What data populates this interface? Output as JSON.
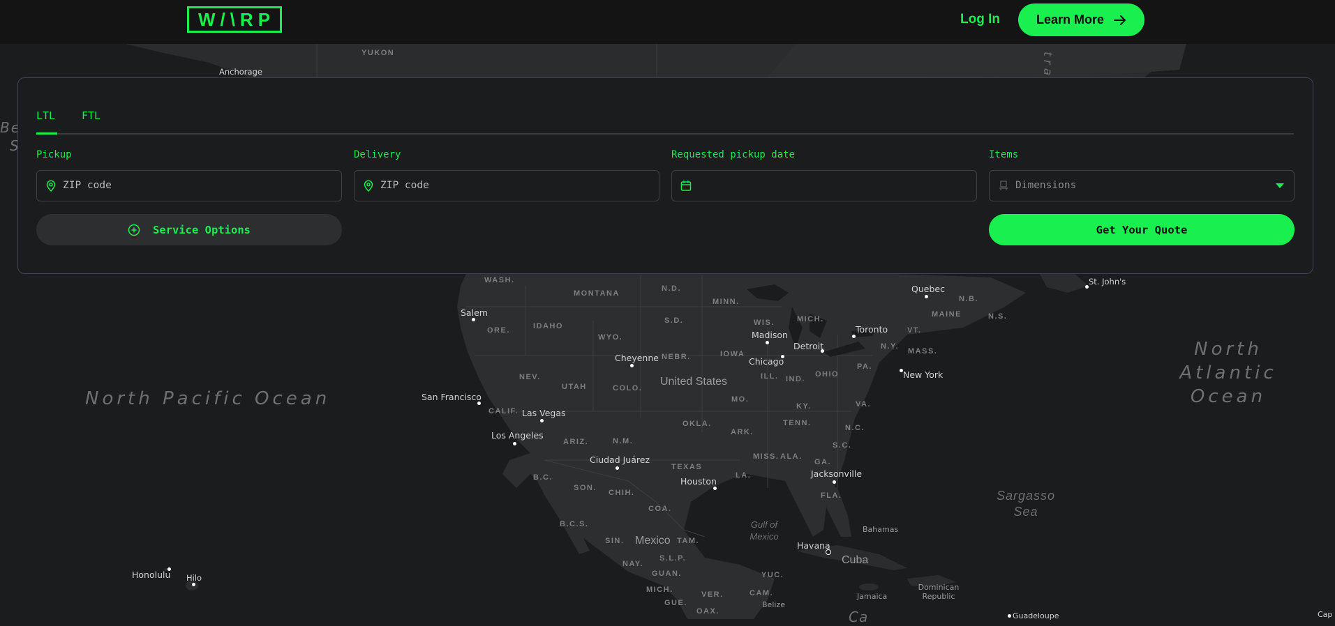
{
  "brand": {
    "logo_text": "W/\\RP",
    "accent": "#19ef4e"
  },
  "header": {
    "login_label": "Log In",
    "learn_more_label": "Learn More",
    "learn_more_icon": "arrow-right-icon"
  },
  "quote_form": {
    "tabs": [
      {
        "label": "LTL",
        "active": true
      },
      {
        "label": "FTL",
        "active": false
      }
    ],
    "fields": {
      "pickup": {
        "label": "Pickup",
        "placeholder": "ZIP code",
        "icon": "location-pin-icon"
      },
      "delivery": {
        "label": "Delivery",
        "placeholder": "ZIP code",
        "icon": "location-pin-icon"
      },
      "pickup_date": {
        "label": "Requested pickup date",
        "placeholder": "",
        "icon": "calendar-icon"
      },
      "items": {
        "label": "Items",
        "placeholder": "Dimensions",
        "icon": "pallet-icon"
      }
    },
    "service_options_label": "Service Options",
    "service_options_icon": "plus-circle-icon",
    "get_quote_label": "Get Your Quote"
  },
  "map": {
    "oceans": [
      "North Pacific Ocean",
      "North Atlantic Ocean",
      "Sargasso Sea",
      "Gulf of Mexico"
    ],
    "countries": [
      "United States",
      "Mexico",
      "Cuba"
    ],
    "partial_labels": {
      "be": "Be",
      "s": "S",
      "trait": "trait",
      "ca": "Ca",
      "cap": "Cap"
    },
    "cities": {
      "anchorage": "Anchorage",
      "salem": "Salem",
      "san_francisco": "San Francisco",
      "las_vegas": "Las Vegas",
      "los_angeles": "Los Angeles",
      "cheyenne": "Cheyenne",
      "madison": "Madison",
      "chicago": "Chicago",
      "detroit": "Detroit",
      "toronto": "Toronto",
      "quebec": "Quebec",
      "st_johns": "St. John's",
      "new_york": "New York",
      "ciudad_juarez": "Ciudad Juárez",
      "houston": "Houston",
      "jacksonville": "Jacksonville",
      "havana": "Havana",
      "bahamas": "Bahamas",
      "jamaica": "Jamaica",
      "dominican_republic": "Dominican Republic",
      "belize": "Belize",
      "guadeloupe": "Guadeloupe",
      "honolulu": "Honolulu",
      "hilo": "Hilo"
    },
    "regions": {
      "yukon": "YUKON",
      "wash": "WASH.",
      "ore": "ORE.",
      "idaho": "IDAHO",
      "montana": "MONTANA",
      "nd": "N.D.",
      "sd": "S.D.",
      "minn": "MINN.",
      "wis": "WIS.",
      "mich": "MICH.",
      "nb": "N.B.",
      "maine": "MAINE",
      "ns": "N.S.",
      "vt": "VT.",
      "ny": "N.Y.",
      "mass": "MASS.",
      "pa": "PA.",
      "ohio": "OHIO",
      "ind": "IND.",
      "ill": "ILL.",
      "iowa": "IOWA",
      "nebr": "NEBR.",
      "wyo": "WYO.",
      "nev": "NEV.",
      "utah": "UTAH",
      "colo": "COLO.",
      "calif": "CALIF.",
      "ariz": "ARIZ.",
      "nm": "N.M.",
      "okla": "OKLA.",
      "mo": "MO.",
      "ky": "KY.",
      "va": "VA.",
      "tenn": "TENN.",
      "nc": "N.C.",
      "ark": "ARK.",
      "sc": "S.C.",
      "texas": "TEXAS",
      "miss": "MISS.",
      "ala": "ALA.",
      "ga": "GA.",
      "la": "LA.",
      "fla": "FLA.",
      "bc": "B.C.",
      "son": "SON.",
      "chih": "CHIH.",
      "coa": "COA.",
      "bcs": "B.C.S.",
      "sin": "SIN.",
      "tam": "TAM.",
      "slp": "S.L.P.",
      "nay": "NAY.",
      "guan": "GUAN.",
      "mich_mx": "MICH.",
      "gue": "GUE.",
      "oax": "OAX.",
      "ver": "VER.",
      "cam": "CAM.",
      "yuc": "YUC."
    }
  }
}
